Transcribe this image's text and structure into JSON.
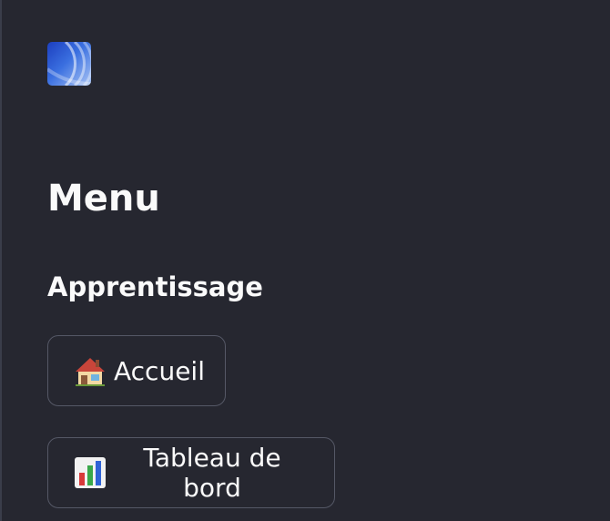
{
  "sidebar": {
    "logo_icon": "app-logo-icon",
    "menu_title": "Menu",
    "section_title": "Apprentissage",
    "items": [
      {
        "label": "Accueil",
        "icon": "house-icon"
      },
      {
        "label": "Tableau de bord",
        "icon": "bar-chart-icon"
      }
    ]
  },
  "colors": {
    "background": "#262730",
    "text": "#fafafa",
    "button_border": "#555866",
    "logo_accent": "#3a6fe0"
  }
}
